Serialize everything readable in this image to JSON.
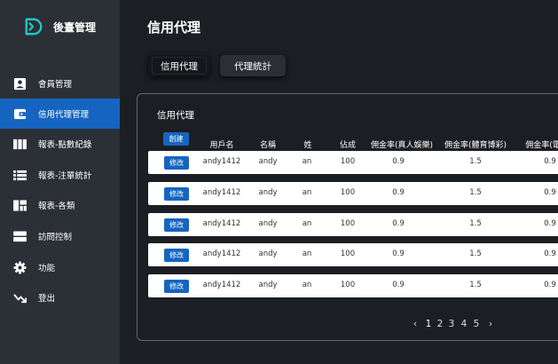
{
  "sidebar": {
    "brand_name": "後臺管理",
    "items": [
      {
        "label": "會員管理",
        "icon": "account-box-icon"
      },
      {
        "label": "信用代理管理",
        "icon": "wallet-icon",
        "active": true
      },
      {
        "label": "報表-點數紀錄",
        "icon": "columns-icon"
      },
      {
        "label": "報表-注單統計",
        "icon": "list-icon"
      },
      {
        "label": "報表-各類",
        "icon": "dashboard-icon"
      },
      {
        "label": "訪問控制",
        "icon": "storage-icon"
      },
      {
        "label": "功能",
        "icon": "gear-icon"
      },
      {
        "label": "登出",
        "icon": "logout-arrow-icon"
      }
    ]
  },
  "main": {
    "title": "信用代理",
    "tabs": [
      "信用代理",
      "代理統計"
    ],
    "active_tab": 0
  },
  "card": {
    "title": "信用代理",
    "create_label": "創建",
    "columns": [
      "用戶名",
      "名稱",
      "姓",
      "佔成",
      "佣金率(真人娛樂)",
      "佣金率(體育博彩)",
      "佣金率(電"
    ],
    "edit_label": "修改",
    "rows": [
      [
        "andy1412",
        "andy",
        "an",
        "100",
        "0.9",
        "1.5",
        "0.9"
      ],
      [
        "andy1412",
        "andy",
        "an",
        "100",
        "0.9",
        "1.5",
        "0.9"
      ],
      [
        "andy1412",
        "andy",
        "an",
        "100",
        "0.9",
        "1.5",
        "0.9"
      ],
      [
        "andy1412",
        "andy",
        "an",
        "100",
        "0.9",
        "1.5",
        "0.9"
      ],
      [
        "andy1412",
        "andy",
        "an",
        "100",
        "0.9",
        "1.5",
        "0.9"
      ]
    ]
  },
  "pagination": {
    "prev": "‹",
    "pages": [
      "1",
      "2",
      "3",
      "4",
      "5"
    ],
    "current": "1",
    "next": "›"
  },
  "colors": {
    "sidebar_bg": "#2b2f36",
    "main_bg": "#1b1e23",
    "accent": "#1565c0",
    "logo_teal": "#1fc8c0"
  }
}
